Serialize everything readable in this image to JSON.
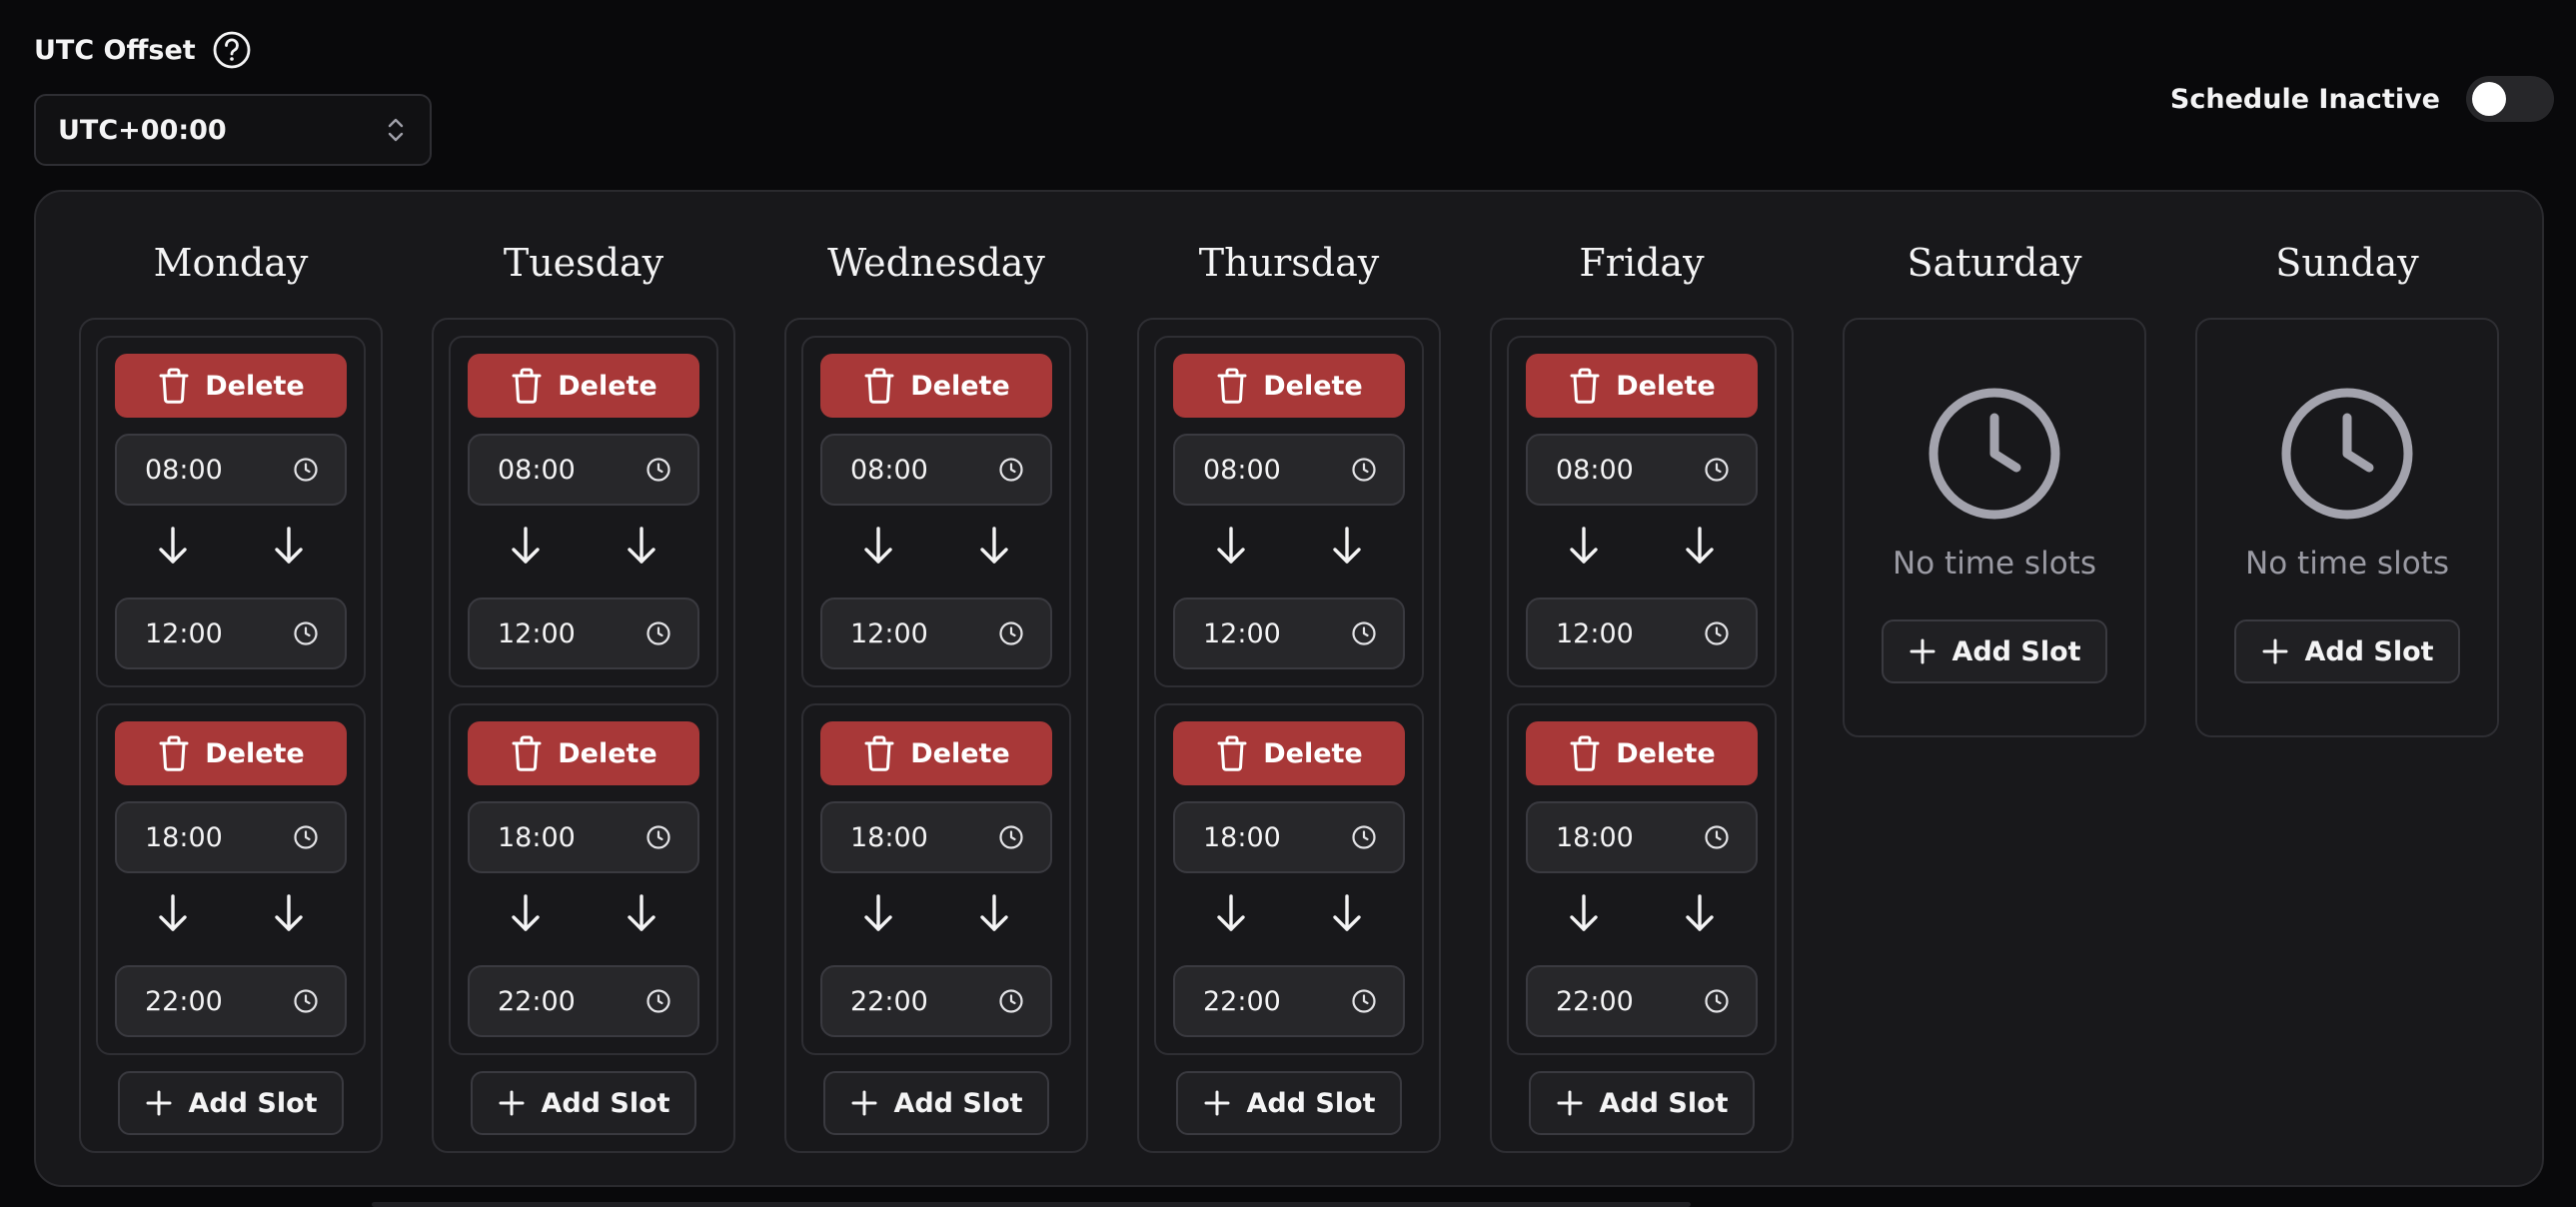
{
  "header": {
    "utc_label": "UTC Offset",
    "help_icon": "question-circle-icon",
    "utc_value": "UTC+00:00",
    "schedule_status": "Schedule Inactive",
    "schedule_active": false
  },
  "labels": {
    "delete": "Delete",
    "add_slot": "Add Slot",
    "no_slots": "No time slots"
  },
  "colors": {
    "delete": "#a83838",
    "background": "#09090b",
    "panel": "#18181b"
  },
  "days": [
    {
      "name": "Monday",
      "slots": [
        {
          "start": "08:00",
          "end": "12:00"
        },
        {
          "start": "18:00",
          "end": "22:00"
        }
      ]
    },
    {
      "name": "Tuesday",
      "slots": [
        {
          "start": "08:00",
          "end": "12:00"
        },
        {
          "start": "18:00",
          "end": "22:00"
        }
      ]
    },
    {
      "name": "Wednesday",
      "slots": [
        {
          "start": "08:00",
          "end": "12:00"
        },
        {
          "start": "18:00",
          "end": "22:00"
        }
      ]
    },
    {
      "name": "Thursday",
      "slots": [
        {
          "start": "08:00",
          "end": "12:00"
        },
        {
          "start": "18:00",
          "end": "22:00"
        }
      ]
    },
    {
      "name": "Friday",
      "slots": [
        {
          "start": "08:00",
          "end": "12:00"
        },
        {
          "start": "18:00",
          "end": "22:00"
        }
      ]
    },
    {
      "name": "Saturday",
      "slots": []
    },
    {
      "name": "Sunday",
      "slots": []
    }
  ]
}
